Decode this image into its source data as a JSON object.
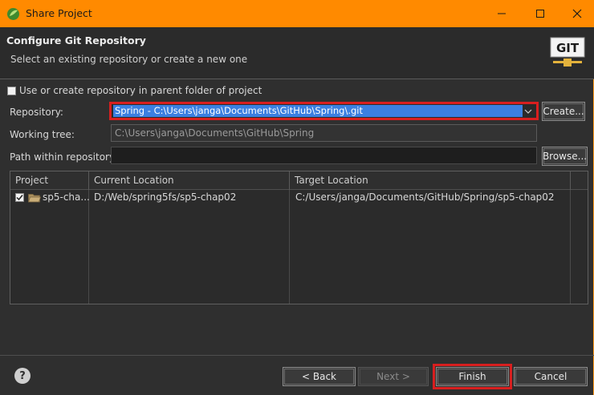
{
  "window": {
    "title": "Share Project",
    "controls": [
      "minimize",
      "maximize",
      "close"
    ]
  },
  "header": {
    "title": "Configure Git Repository",
    "subtitle": "Select an existing repository or create a new one",
    "logo_text": "GIT"
  },
  "form": {
    "parent_checkbox_label": "Use or create repository in parent folder of project",
    "parent_checkbox_checked": false,
    "repository_label": "Repository:",
    "repository_value": "Spring - C:\\Users\\janga\\Documents\\GitHub\\Spring\\.git",
    "create_button": "Create...",
    "working_tree_label": "Working tree:",
    "working_tree_value": "C:\\Users\\janga\\Documents\\GitHub\\Spring",
    "path_label": "Path within repository:",
    "path_value": "",
    "browse_button": "Browse..."
  },
  "table": {
    "columns": [
      "Project",
      "Current Location",
      "Target Location"
    ],
    "rows": [
      {
        "checked": true,
        "project": "sp5-cha...",
        "current": "D:/Web/spring5fs/sp5-chap02",
        "target": "C:/Users/janga/Documents/GitHub/Spring/sp5-chap02"
      }
    ]
  },
  "footer": {
    "help": "?",
    "back": "< Back",
    "next": "Next >",
    "finish": "Finish",
    "cancel": "Cancel"
  },
  "colors": {
    "titlebar": "#ff8a00",
    "highlight": "#d81f1f",
    "selection": "#3b7fe0"
  }
}
